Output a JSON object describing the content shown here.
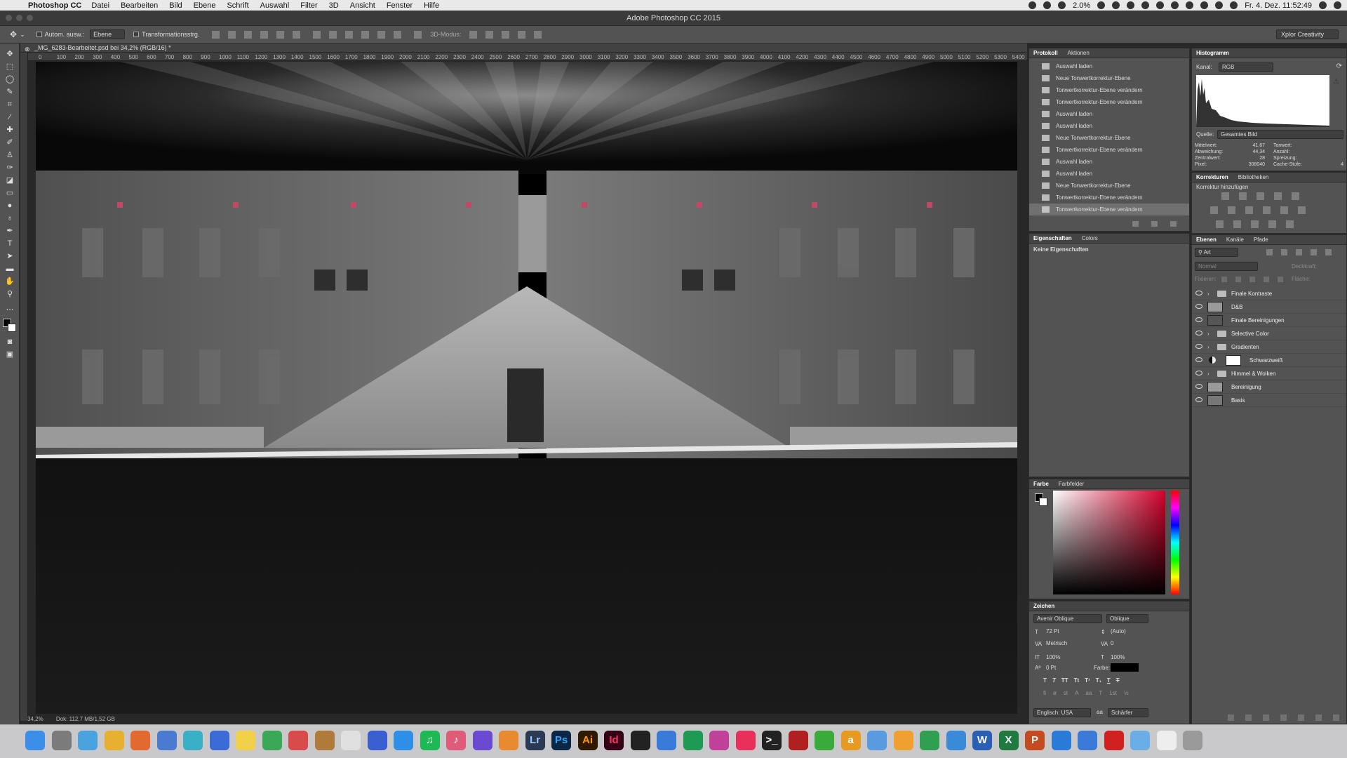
{
  "menubar": {
    "app": "Photoshop CC",
    "items": [
      "Datei",
      "Bearbeiten",
      "Bild",
      "Ebene",
      "Schrift",
      "Auswahl",
      "Filter",
      "3D",
      "Ansicht",
      "Fenster",
      "Hilfe"
    ],
    "battery": "2.0%",
    "clock": "Fr. 4. Dez. 11:52:49"
  },
  "window_title": "Adobe Photoshop CC 2015",
  "options": {
    "auto_select_label": "Autom. ausw.:",
    "auto_select_target": "Ebene",
    "transform_label": "Transformationsstrg.",
    "mode3d_label": "3D-Modus:",
    "workspace": "Xplor Creativity"
  },
  "document": {
    "tab": "_MG_6283-Bearbeitet.psd bei 34,2% (RGB/16) *",
    "ruler_ticks": [
      "0",
      "100",
      "200",
      "300",
      "400",
      "500",
      "600",
      "700",
      "800",
      "900",
      "1000",
      "1100",
      "1200",
      "1300",
      "1400",
      "1500",
      "1600",
      "1700",
      "1800",
      "1900",
      "2000",
      "2100",
      "2200",
      "2300",
      "2400",
      "2500",
      "2600",
      "2700",
      "2800",
      "2900",
      "3000",
      "3100",
      "3200",
      "3300",
      "3400",
      "3500",
      "3600",
      "3700",
      "3800",
      "3900",
      "4000",
      "4100",
      "4200",
      "4300",
      "4400",
      "4500",
      "4600",
      "4700",
      "4800",
      "4900",
      "5000",
      "5100",
      "5200",
      "5300",
      "5400"
    ],
    "zoom": "34,2%",
    "doc_size": "Dok: 112,7 MB/1,52 GB"
  },
  "history_panel": {
    "tabs": [
      "Protokoll",
      "Aktionen"
    ],
    "states": [
      "Auswahl laden",
      "Neue Tonwertkorrektur-Ebene",
      "Tonwertkorrektur-Ebene verändern",
      "Tonwertkorrektur-Ebene verändern",
      "Auswahl laden",
      "Auswahl laden",
      "Neue Tonwertkorrektur-Ebene",
      "Tonwertkorrektur-Ebene verändern",
      "Auswahl laden",
      "Auswahl laden",
      "Neue Tonwertkorrektur-Ebene",
      "Tonwertkorrektur-Ebene verändern",
      "Tonwertkorrektur-Ebene verändern"
    ],
    "selected_index": 12
  },
  "properties_panel": {
    "tabs": [
      "Eigenschaften",
      "Colors"
    ],
    "message": "Keine Eigenschaften"
  },
  "color_panel": {
    "tabs": [
      "Farbe",
      "Farbfelder"
    ]
  },
  "character_panel": {
    "title": "Zeichen",
    "font": "Avenir Oblique",
    "style": "Oblique",
    "size": "72 Pt",
    "leading": "(Auto)",
    "kerning": "Metrisch",
    "tracking": "0",
    "vscale": "100%",
    "hscale": "100%",
    "baseline": "0 Pt",
    "color_label": "Farbe:",
    "language": "Englisch: USA",
    "antialias": "Schärfer"
  },
  "histogram_panel": {
    "title": "Histogramm",
    "channel_label": "Kanal:",
    "channel": "RGB",
    "source_label": "Quelle:",
    "source": "Gesamtes Bild",
    "stats_left": [
      [
        "Mittelwert:",
        "41,67"
      ],
      [
        "Abweichung:",
        "44,34"
      ],
      [
        "Zentralwert:",
        "28"
      ],
      [
        "Pixel:",
        "308040"
      ]
    ],
    "stats_right": [
      [
        "Tonwert:",
        ""
      ],
      [
        "Anzahl:",
        ""
      ],
      [
        "Spreizung:",
        ""
      ],
      [
        "Cache-Stufe:",
        "4"
      ]
    ]
  },
  "adjustments_panel": {
    "tabs": [
      "Korrekturen",
      "Bibliotheken"
    ],
    "label": "Korrektur hinzufügen"
  },
  "layers_panel": {
    "tabs": [
      "Ebenen",
      "Kanäle",
      "Pfade"
    ],
    "filter_kind": "Art",
    "blend_mode": "Normal",
    "opacity_label": "Deckkraft:",
    "lock_label": "Fixieren:",
    "fill_label": "Fläche:",
    "layers": [
      {
        "name": "Finale Kontraste",
        "kind": "folder"
      },
      {
        "name": "D&B",
        "kind": "pixel"
      },
      {
        "name": "Finale Bereinigungen",
        "kind": "pixel"
      },
      {
        "name": "Selective Color",
        "kind": "folder"
      },
      {
        "name": "Gradienten",
        "kind": "folder"
      },
      {
        "name": "Schwarzweiß",
        "kind": "adjustment"
      },
      {
        "name": "Himmel & Wolken",
        "kind": "folder"
      },
      {
        "name": "Bereinigung",
        "kind": "pixel"
      },
      {
        "name": "Basis",
        "kind": "pixel"
      }
    ]
  },
  "dock": {
    "apps": [
      "Finder",
      "Launchpad",
      "Safari",
      "Chrome",
      "Firefox",
      "Mail",
      "Preview",
      "1Password",
      "Notes",
      "Evernote",
      "Tasks",
      "Books",
      "Photos",
      "Network",
      "App Store",
      "Spotify",
      "iTunes",
      "iMovie",
      "Fruit",
      "Lr",
      "Ps",
      "Ai",
      "Id",
      "Camera",
      "Keynote",
      "Numbers",
      "Pinwheel",
      "Lips",
      "Terminal",
      "FileZilla",
      "Leaf",
      "Amazon",
      "Maps",
      "Pages",
      "Charts",
      "Print",
      "Word",
      "Excel",
      "PowerPoint",
      "Globe",
      "Finder2",
      "Acrobat",
      "Folder",
      "Documents",
      "Trash"
    ]
  }
}
